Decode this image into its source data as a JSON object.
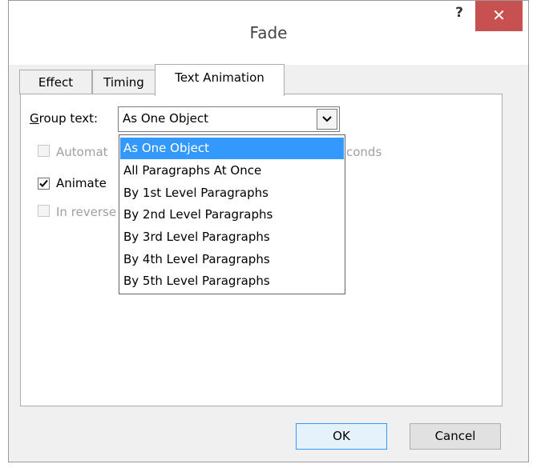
{
  "window": {
    "title": "Fade",
    "help_label": "?",
    "close_label": "✕"
  },
  "tabs": [
    {
      "label": "Effect"
    },
    {
      "label": "Timing"
    },
    {
      "label": "Text Animation"
    }
  ],
  "group_text": {
    "label": "Group text:",
    "value": "As One Object"
  },
  "options": {
    "automatic": {
      "label": "Automat",
      "suffix": "conds",
      "checked": false,
      "enabled": false
    },
    "animate": {
      "label": "Animate",
      "checked": true,
      "enabled": true
    },
    "reverse": {
      "label": "In reverse",
      "checked": false,
      "enabled": false
    }
  },
  "dropdown": {
    "items": [
      "As One Object",
      "All Paragraphs At Once",
      "By 1st Level Paragraphs",
      "By 2nd Level Paragraphs",
      "By 3rd Level Paragraphs",
      "By 4th Level Paragraphs",
      "By 5th Level Paragraphs"
    ],
    "selected_index": 0
  },
  "buttons": {
    "ok": "OK",
    "cancel": "Cancel"
  },
  "colors": {
    "close_bg": "#c75050",
    "selection": "#3399ff"
  }
}
